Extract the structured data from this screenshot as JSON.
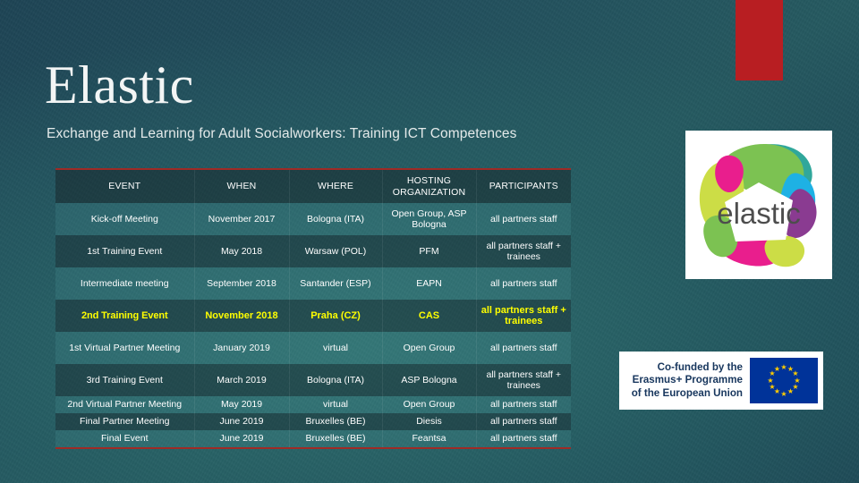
{
  "slide": {
    "title": "Elastic",
    "subtitle": "Exchange and Learning for Adult Socialworkers: Training ICT Competences",
    "accent_red": "#b81e22",
    "background_teal": "#22505d",
    "highlight_yellow": "#ffff00",
    "table_border_red": "#9e2b26"
  },
  "table": {
    "headers": [
      "EVENT",
      "WHEN",
      "WHERE",
      "HOSTING ORGANIZATION",
      "PARTICIPANTS"
    ],
    "rows": [
      {
        "event": "Kick-off Meeting",
        "when": "November 2017",
        "where": "Bologna (ITA)",
        "host": "Open Group, ASP Bologna",
        "participants": "all partners staff",
        "highlight": false
      },
      {
        "event": "1st Training Event",
        "when": "May 2018",
        "where": "Warsaw (POL)",
        "host": "PFM",
        "participants": "all partners staff + trainees",
        "highlight": false
      },
      {
        "event": "Intermediate meeting",
        "when": "September 2018",
        "where": "Santander (ESP)",
        "host": "EAPN",
        "participants": "all partners staff",
        "highlight": false
      },
      {
        "event": "2nd Training Event",
        "when": "November 2018",
        "where": "Praha (CZ)",
        "host": "CAS",
        "participants": "all partners staff + trainees",
        "highlight": true
      },
      {
        "event": "1st Virtual Partner Meeting",
        "when": "January 2019",
        "where": "virtual",
        "host": "Open Group",
        "participants": "all partners staff",
        "highlight": false
      },
      {
        "event": "3rd Training Event",
        "when": "March 2019",
        "where": "Bologna (ITA)",
        "host": "ASP Bologna",
        "participants": "all partners staff + trainees",
        "highlight": false
      },
      {
        "event": "2nd Virtual Partner Meeting",
        "when": "May 2019",
        "where": "virtual",
        "host": "Open Group",
        "participants": "all partners staff",
        "highlight": false
      },
      {
        "event": "Final Partner Meeting",
        "when": "June 2019",
        "where": "Bruxelles (BE)",
        "host": "Diesis",
        "participants": "all partners staff",
        "highlight": false
      },
      {
        "event": "Final Event",
        "when": "June 2019",
        "where": "Bruxelles (BE)",
        "host": "Feantsa",
        "participants": "all partners staff",
        "highlight": false
      }
    ]
  },
  "elastic_logo": {
    "wordmark": "elastic",
    "colors": [
      "#149c8e",
      "#6aba3b",
      "#c6d92d",
      "#e6007e",
      "#00a7e1",
      "#7a2182"
    ]
  },
  "erasmus_logo": {
    "line1": "Co-funded by the",
    "line2": "Erasmus+ Programme",
    "line3": "of the European Union",
    "flag_blue": "#003399",
    "star_yellow": "#ffcc00"
  }
}
